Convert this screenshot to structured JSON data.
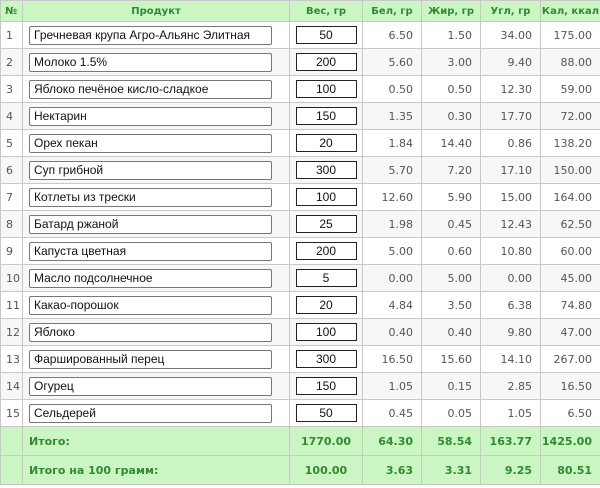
{
  "headers": [
    "№",
    "Продукт",
    "Вес, гр",
    "Бел, гр",
    "Жир, гр",
    "Угл, гр",
    "Кал, ккал"
  ],
  "rows": [
    {
      "n": "1",
      "product": "Гречневая крупа Агро-Альянс Элитная",
      "weight": "50",
      "protein": "6.50",
      "fat": "1.50",
      "carbs": "34.00",
      "kcal": "175.00"
    },
    {
      "n": "2",
      "product": "Молоко 1.5%",
      "weight": "200",
      "protein": "5.60",
      "fat": "3.00",
      "carbs": "9.40",
      "kcal": "88.00"
    },
    {
      "n": "3",
      "product": "Яблоко печёное кисло-сладкое",
      "weight": "100",
      "protein": "0.50",
      "fat": "0.50",
      "carbs": "12.30",
      "kcal": "59.00"
    },
    {
      "n": "4",
      "product": "Нектарин",
      "weight": "150",
      "protein": "1.35",
      "fat": "0.30",
      "carbs": "17.70",
      "kcal": "72.00"
    },
    {
      "n": "5",
      "product": "Орех пекан",
      "weight": "20",
      "protein": "1.84",
      "fat": "14.40",
      "carbs": "0.86",
      "kcal": "138.20"
    },
    {
      "n": "6",
      "product": "Суп грибной",
      "weight": "300",
      "protein": "5.70",
      "fat": "7.20",
      "carbs": "17.10",
      "kcal": "150.00"
    },
    {
      "n": "7",
      "product": "Котлеты из трески",
      "weight": "100",
      "protein": "12.60",
      "fat": "5.90",
      "carbs": "15.00",
      "kcal": "164.00"
    },
    {
      "n": "8",
      "product": "Батард ржаной",
      "weight": "25",
      "protein": "1.98",
      "fat": "0.45",
      "carbs": "12.43",
      "kcal": "62.50"
    },
    {
      "n": "9",
      "product": "Капуста цветная",
      "weight": "200",
      "protein": "5.00",
      "fat": "0.60",
      "carbs": "10.80",
      "kcal": "60.00"
    },
    {
      "n": "10",
      "product": "Масло подсолнечное",
      "weight": "5",
      "protein": "0.00",
      "fat": "5.00",
      "carbs": "0.00",
      "kcal": "45.00"
    },
    {
      "n": "11",
      "product": "Какао-порошок",
      "weight": "20",
      "protein": "4.84",
      "fat": "3.50",
      "carbs": "6.38",
      "kcal": "74.80"
    },
    {
      "n": "12",
      "product": "Яблоко",
      "weight": "100",
      "protein": "0.40",
      "fat": "0.40",
      "carbs": "9.80",
      "kcal": "47.00"
    },
    {
      "n": "13",
      "product": "Фаршированный перец",
      "weight": "300",
      "protein": "16.50",
      "fat": "15.60",
      "carbs": "14.10",
      "kcal": "267.00"
    },
    {
      "n": "14",
      "product": "Огурец",
      "weight": "150",
      "protein": "1.05",
      "fat": "0.15",
      "carbs": "2.85",
      "kcal": "16.50"
    },
    {
      "n": "15",
      "product": "Сельдерей",
      "weight": "50",
      "protein": "0.45",
      "fat": "0.05",
      "carbs": "1.05",
      "kcal": "6.50"
    }
  ],
  "totals": {
    "label": "Итого:",
    "weight": "1770.00",
    "protein": "64.30",
    "fat": "58.54",
    "carbs": "163.77",
    "kcal": "1425.00"
  },
  "per100": {
    "label": "Итого на 100 грамм:",
    "weight": "100.00",
    "protein": "3.63",
    "fat": "3.31",
    "carbs": "9.25",
    "kcal": "80.51"
  },
  "colors": {
    "header_bg": "#ccf5c4",
    "header_text": "#2e8b2e"
  }
}
